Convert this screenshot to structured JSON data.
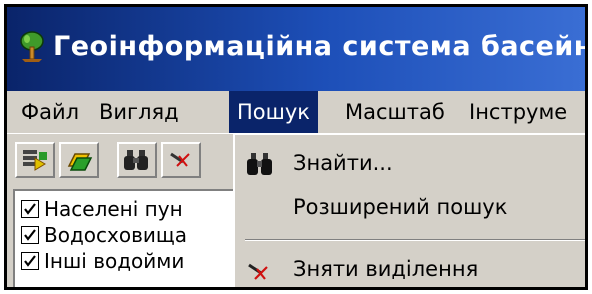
{
  "window": {
    "title": "Геоінформаційна система басейн"
  },
  "menubar": {
    "items": [
      {
        "label": "Файл"
      },
      {
        "label": "Вигляд"
      },
      {
        "label": "Пошук"
      },
      {
        "label": "Масштаб"
      },
      {
        "label": "Інструме"
      }
    ],
    "active": "Пошук"
  },
  "toolbar": {
    "buttons": [
      {
        "icon": "layer-add-icon"
      },
      {
        "icon": "layer-edit-icon"
      },
      {
        "icon": "binoculars-icon"
      },
      {
        "icon": "clear-selection-icon"
      }
    ]
  },
  "layers": [
    {
      "label": "Населені пун",
      "checked": true
    },
    {
      "label": "Водосховища",
      "checked": true
    },
    {
      "label": "Інші водойми",
      "checked": true
    }
  ],
  "search_menu": {
    "items": [
      {
        "label": "Знайти...",
        "icon": "binoculars-icon"
      },
      {
        "label": "Розширений пошук",
        "icon": ""
      },
      {
        "label": "Зняти виділення",
        "icon": "clear-selection-icon"
      }
    ]
  },
  "colors": {
    "title_bar": "#0a246a",
    "menu_highlight": "#0a246a",
    "face": "#d4d0c8"
  }
}
